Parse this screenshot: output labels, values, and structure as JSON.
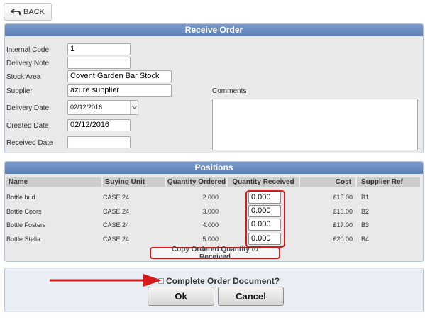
{
  "back_label": "BACK",
  "order": {
    "title": "Receive Order",
    "fields": {
      "internal_code": {
        "label": "Internal Code",
        "value": "1"
      },
      "delivery_note": {
        "label": "Delivery Note",
        "value": ""
      },
      "stock_area": {
        "label": "Stock Area",
        "value": "Covent Garden Bar Stock"
      },
      "supplier": {
        "label": "Supplier",
        "value": "azure supplier"
      },
      "delivery_date": {
        "label": "Delivery Date",
        "value": "02/12/2016"
      },
      "created_date": {
        "label": "Created Date",
        "value": "02/12/2016"
      },
      "received_date": {
        "label": "Received Date",
        "value": ""
      }
    },
    "comments_label": "Comments",
    "comments_value": ""
  },
  "positions": {
    "title": "Positions",
    "columns": [
      "Name",
      "Buying Unit",
      "Quantity Ordered",
      "Quantity Received",
      "Cost",
      "Supplier Ref"
    ],
    "rows": [
      {
        "name": "Bottle bud",
        "unit": "CASE 24",
        "ordered": "2.000",
        "received": "0.000",
        "cost": "£15.00",
        "ref": "B1"
      },
      {
        "name": "Bottle Coors",
        "unit": "CASE 24",
        "ordered": "3.000",
        "received": "0.000",
        "cost": "£15.00",
        "ref": "B2"
      },
      {
        "name": "Bottle Fosters",
        "unit": "CASE 24",
        "ordered": "4.000",
        "received": "0.000",
        "cost": "£17.00",
        "ref": "B3"
      },
      {
        "name": "Bottle Stella",
        "unit": "CASE 24",
        "ordered": "5.000",
        "received": "0.000",
        "cost": "£20.00",
        "ref": "B4"
      }
    ],
    "copy_label": "Copy Ordered Quantity to Received"
  },
  "footer": {
    "complete_label": "Complete Order Document?",
    "complete_checked": false,
    "ok_label": "Ok",
    "cancel_label": "Cancel"
  },
  "colors": {
    "header": "#5b7fb6",
    "highlight": "#d41a1a"
  },
  "icons": {
    "back": "back-arrow-icon",
    "dropdown": "chevron-down-icon",
    "callout": "red-arrow-icon"
  }
}
